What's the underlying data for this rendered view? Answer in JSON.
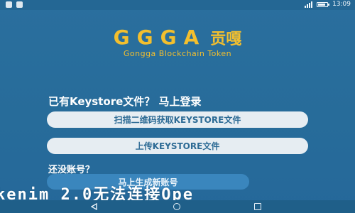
{
  "status_bar": {
    "time": "13:09"
  },
  "logo": {
    "letters": "GGGA",
    "cn": "贡嘎",
    "subtitle": "Gongga Blockchain Token"
  },
  "login": {
    "heading": "已有Keystore文件？ 马上登录",
    "scan_button": "扫描二维码获取KEYSTORE文件",
    "upload_button": "上传KEYSTORE文件"
  },
  "register": {
    "heading": "还没账号？",
    "create_button": "马上生成新账号"
  },
  "overlay": {
    "text": "kenim 2.0无法连接Ope"
  },
  "colors": {
    "background": "#2a6f9e",
    "brand": "#f3bf2e",
    "button_light": "#e6edf2",
    "button_accent": "#3a86bd"
  },
  "icons": {
    "nav_back": "back-triangle-icon",
    "nav_home": "home-circle-icon",
    "nav_recent": "recent-square-icon",
    "signal": "signal-icon",
    "battery": "battery-icon"
  }
}
